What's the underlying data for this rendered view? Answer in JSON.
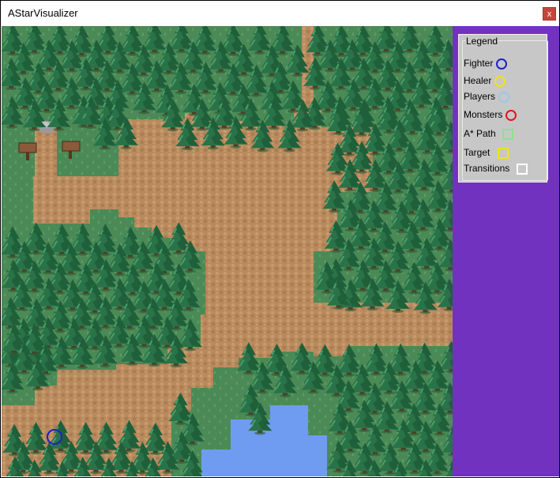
{
  "window": {
    "title": "AStarVisualizer",
    "close_label": "x"
  },
  "legend": {
    "title": "Legend",
    "items": [
      {
        "label": "Fighter",
        "shape": "circle",
        "color": "#1a22c8"
      },
      {
        "label": "Healer",
        "shape": "circle",
        "color": "#f2e21a"
      },
      {
        "label": "Players",
        "shape": "circle",
        "color": "#9ec6e6"
      },
      {
        "label": "Monsters",
        "shape": "circle",
        "color": "#e01818"
      },
      {
        "label": "A* Path",
        "shape": "square",
        "color": "#8ee08e"
      },
      {
        "label": "Target",
        "shape": "square",
        "color": "#f2e21a"
      },
      {
        "label": "Transitions",
        "shape": "square",
        "color": "#ffffff"
      }
    ]
  },
  "map": {
    "colors": {
      "grass": "#4b8a56",
      "dirt": "#b88a5e",
      "water": "#6f9cf1",
      "tree_dark": "#1f5f3a",
      "tree_light": "#3d8f5c",
      "trunk": "#5a3521"
    },
    "fighter_marker_color": "#1a22c8",
    "signs": [
      "sign",
      "sign"
    ],
    "rock": "rock"
  }
}
